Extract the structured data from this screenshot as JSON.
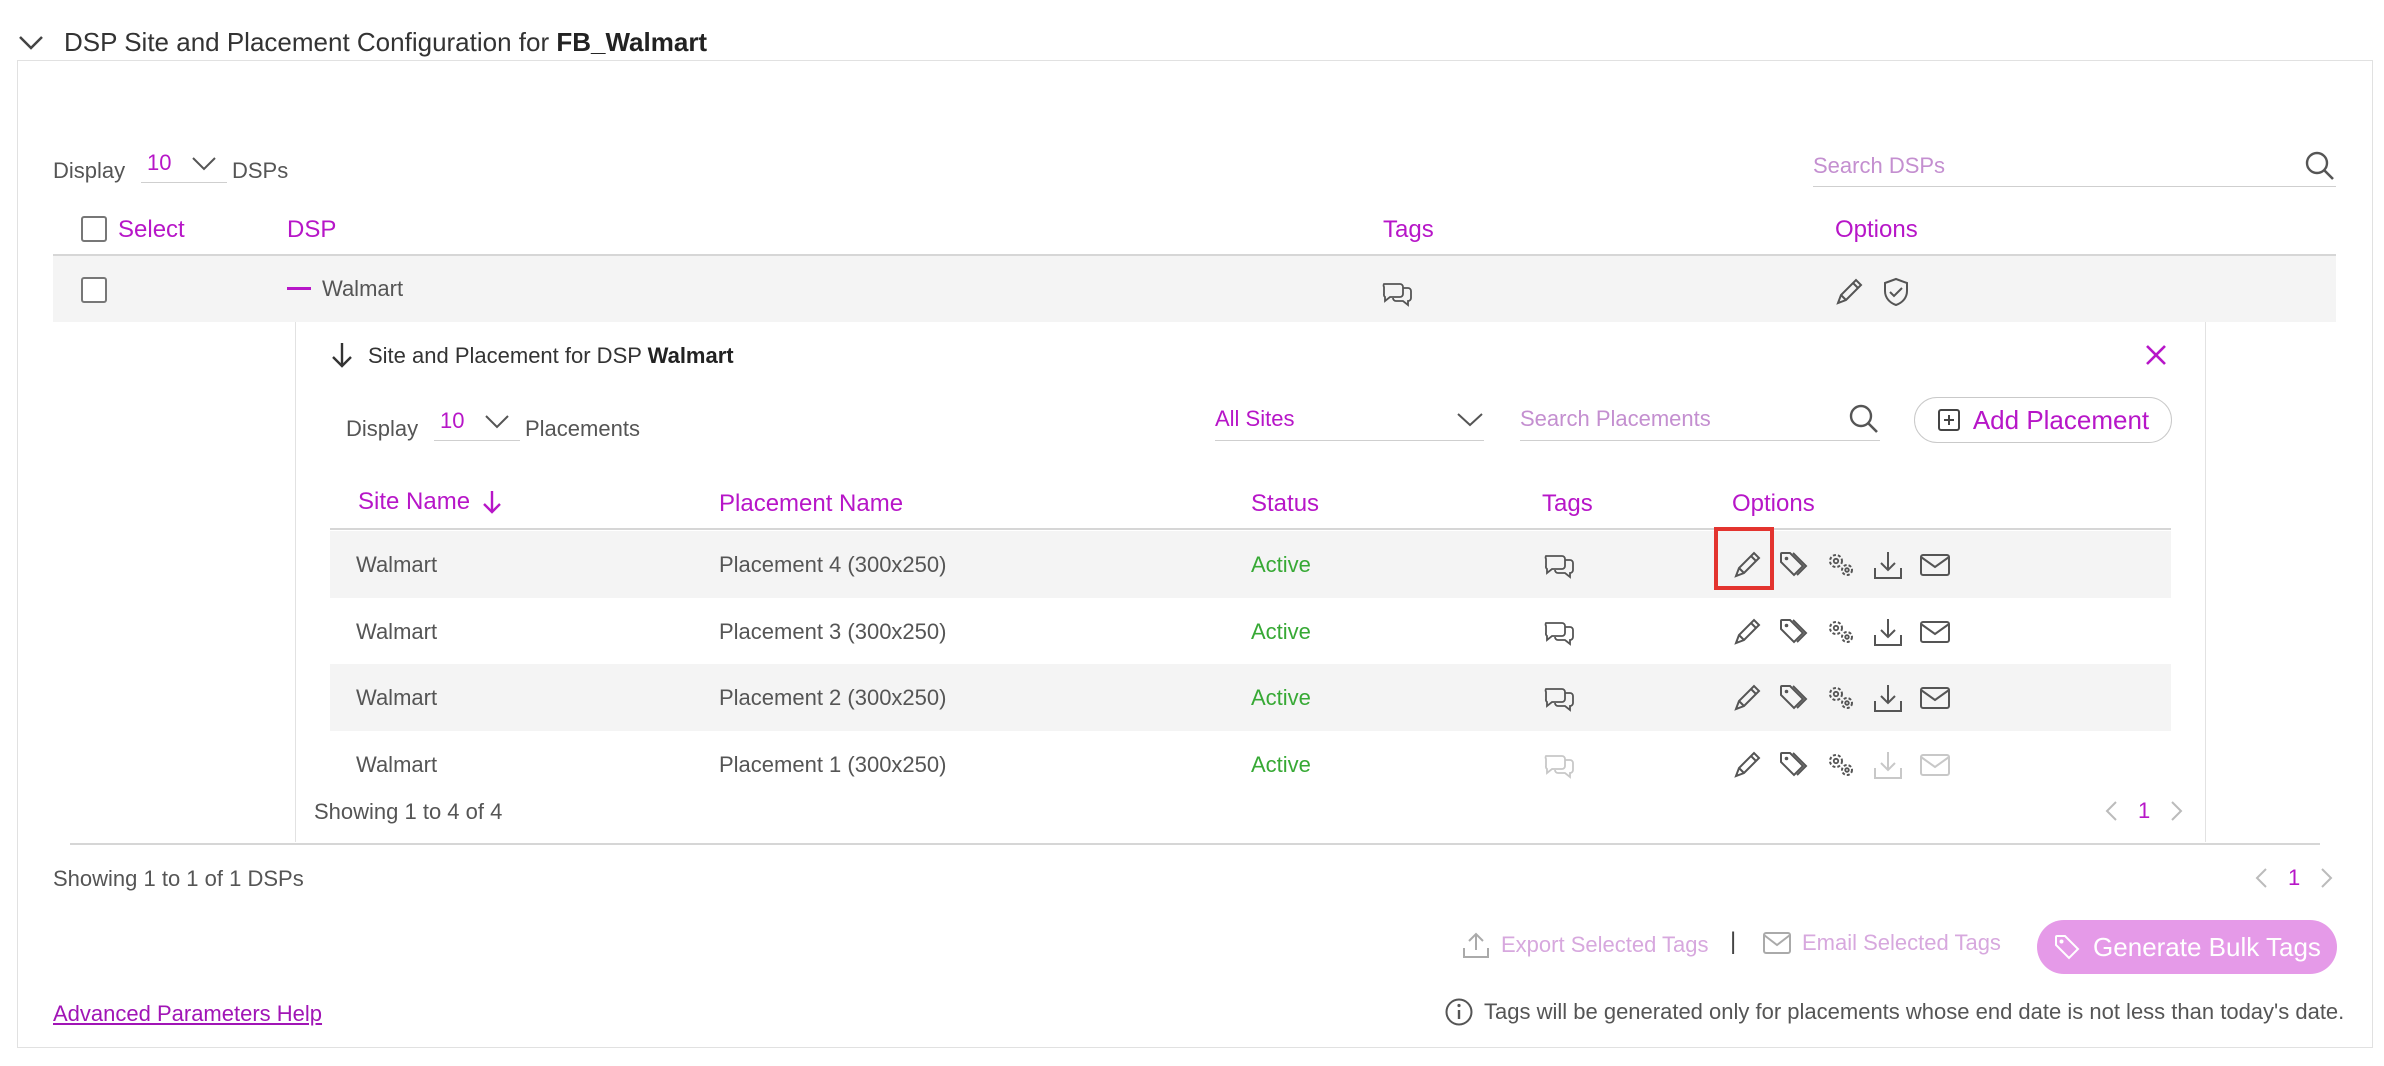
{
  "header": {
    "title_prefix": "DSP Site and Placement Configuration for ",
    "title_entity": "FB_Walmart"
  },
  "dsp_controls": {
    "display_label": "Display",
    "page_size": "10",
    "display_suffix": "DSPs",
    "search_placeholder": "Search DSPs"
  },
  "dsp_table": {
    "headers": {
      "select": "Select",
      "dsp": "DSP",
      "tags": "Tags",
      "options": "Options"
    },
    "rows": [
      {
        "dsp": "Walmart"
      }
    ]
  },
  "inner": {
    "title_prefix": "Site and Placement for DSP ",
    "title_entity": "Walmart",
    "display_label": "Display",
    "page_size": "10",
    "display_suffix": "Placements",
    "site_filter": "All Sites",
    "search_placeholder": "Search Placements",
    "add_label": "Add Placement",
    "headers": {
      "site": "Site Name",
      "placement": "Placement Name",
      "status": "Status",
      "tags": "Tags",
      "options": "Options"
    },
    "rows": [
      {
        "site": "Walmart",
        "placement": "Placement 4 (300x250)",
        "status": "Active"
      },
      {
        "site": "Walmart",
        "placement": "Placement 3 (300x250)",
        "status": "Active"
      },
      {
        "site": "Walmart",
        "placement": "Placement 2 (300x250)",
        "status": "Active"
      },
      {
        "site": "Walmart",
        "placement": "Placement 1 (300x250)",
        "status": "Active"
      }
    ],
    "showing": "Showing 1 to 4 of 4",
    "page": "1"
  },
  "footer": {
    "showing": "Showing 1 to 1 of 1 DSPs",
    "page": "1",
    "export_label": "Export Selected Tags",
    "separator": "|",
    "email_label": "Email Selected Tags",
    "generate_label": "Generate Bulk Tags",
    "help_link": "Advanced Parameters Help",
    "note": "Tags will be generated only for placements whose end date is not less than today's date."
  },
  "colors": {
    "accent": "#b716c8",
    "active": "#37a935",
    "generate_bg": "#e59ae8",
    "highlight": "#e3342f"
  }
}
